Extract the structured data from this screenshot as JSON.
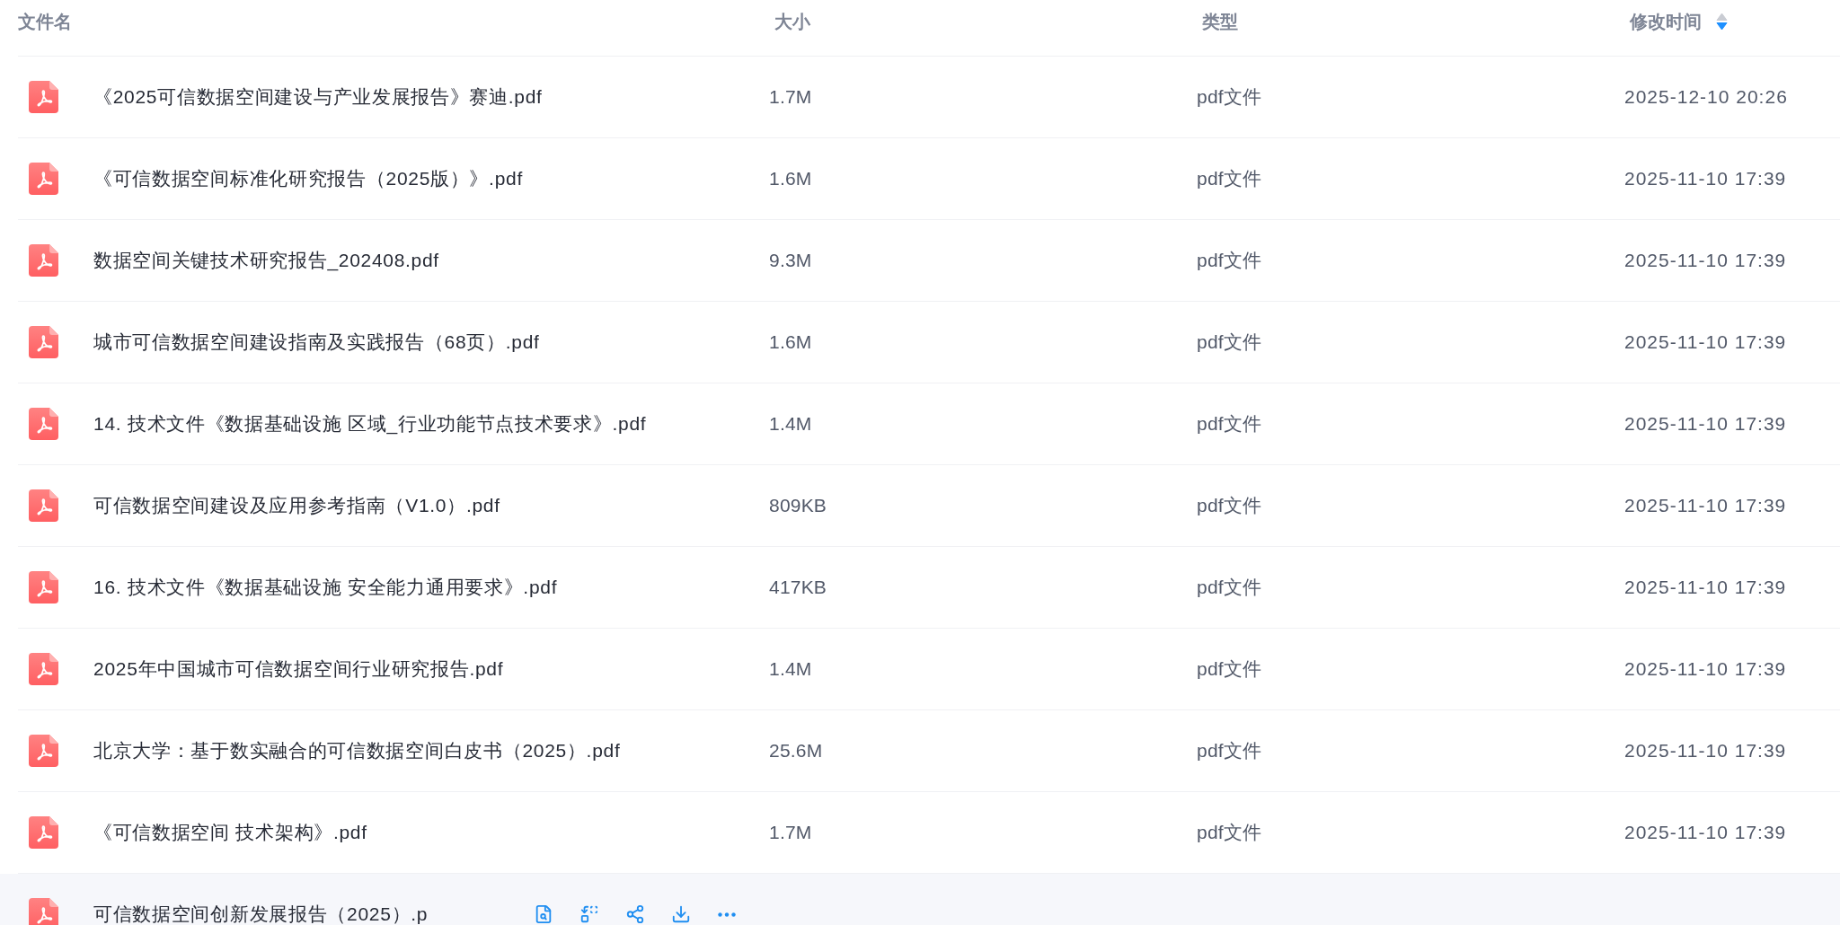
{
  "table": {
    "columns": [
      {
        "label": "文件名"
      },
      {
        "label": "大小"
      },
      {
        "label": "类型"
      },
      {
        "label": "修改时间",
        "sort_descending": true
      }
    ],
    "rows": [
      {
        "name": "《2025可信数据空间建设与产业发展报告》赛迪.pdf",
        "size": "1.7M",
        "type": "pdf文件",
        "modified": "2025-12-10 20:26",
        "hovered": false
      },
      {
        "name": "《可信数据空间标准化研究报告（2025版）》.pdf",
        "size": "1.6M",
        "type": "pdf文件",
        "modified": "2025-11-10 17:39",
        "hovered": false
      },
      {
        "name": "数据空间关键技术研究报告_202408.pdf",
        "size": "9.3M",
        "type": "pdf文件",
        "modified": "2025-11-10 17:39",
        "hovered": false
      },
      {
        "name": "城市可信数据空间建设指南及实践报告（68页）.pdf",
        "size": "1.6M",
        "type": "pdf文件",
        "modified": "2025-11-10 17:39",
        "hovered": false
      },
      {
        "name": "14. 技术文件《数据基础设施 区域_行业功能节点技术要求》.pdf",
        "size": "1.4M",
        "type": "pdf文件",
        "modified": "2025-11-10 17:39",
        "hovered": false
      },
      {
        "name": "可信数据空间建设及应用参考指南（V1.0）.pdf",
        "size": "809KB",
        "type": "pdf文件",
        "modified": "2025-11-10 17:39",
        "hovered": false
      },
      {
        "name": "16. 技术文件《数据基础设施 安全能力通用要求》.pdf",
        "size": "417KB",
        "type": "pdf文件",
        "modified": "2025-11-10 17:39",
        "hovered": false
      },
      {
        "name": "2025年中国城市可信数据空间行业研究报告.pdf",
        "size": "1.4M",
        "type": "pdf文件",
        "modified": "2025-11-10 17:39",
        "hovered": false
      },
      {
        "name": "北京大学：基于数实融合的可信数据空间白皮书（2025）.pdf",
        "size": "25.6M",
        "type": "pdf文件",
        "modified": "2025-11-10 17:39",
        "hovered": false
      },
      {
        "name": "《可信数据空间 技术架构》.pdf",
        "size": "1.7M",
        "type": "pdf文件",
        "modified": "2025-11-10 17:39",
        "hovered": false
      },
      {
        "name": "可信数据空间创新发展报告（2025）.p",
        "hovered": true
      }
    ]
  }
}
